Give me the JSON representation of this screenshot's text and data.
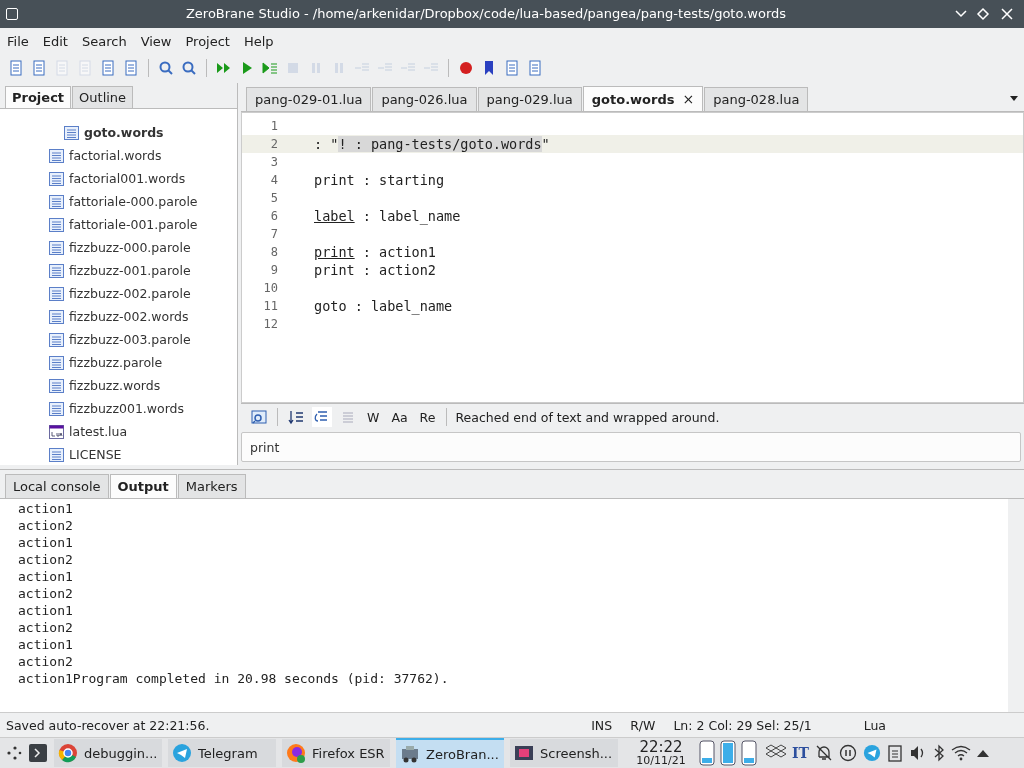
{
  "window": {
    "title": "ZeroBrane Studio - /home/arkenidar/Dropbox/code/lua-based/pangea/pang-tests/goto.words"
  },
  "menu": [
    "File",
    "Edit",
    "Search",
    "View",
    "Project",
    "Help"
  ],
  "toolbar": [
    {
      "kind": "new",
      "disabled": false
    },
    {
      "kind": "open",
      "disabled": false
    },
    {
      "kind": "save",
      "disabled": true
    },
    {
      "kind": "saveall",
      "disabled": true
    },
    {
      "kind": "find-project",
      "disabled": false
    },
    {
      "kind": "folder",
      "disabled": false
    },
    {
      "kind": "sep"
    },
    {
      "kind": "find",
      "disabled": false
    },
    {
      "kind": "replace",
      "disabled": false
    },
    {
      "kind": "sep"
    },
    {
      "kind": "run",
      "disabled": false
    },
    {
      "kind": "play",
      "disabled": false
    },
    {
      "kind": "step",
      "disabled": false
    },
    {
      "kind": "stop",
      "disabled": true
    },
    {
      "kind": "continue",
      "disabled": true
    },
    {
      "kind": "pause",
      "disabled": true
    },
    {
      "kind": "stepin",
      "disabled": true
    },
    {
      "kind": "stepout",
      "disabled": true
    },
    {
      "kind": "stepover",
      "disabled": true
    },
    {
      "kind": "runto",
      "disabled": true
    },
    {
      "kind": "sep"
    },
    {
      "kind": "breakpoint",
      "disabled": false
    },
    {
      "kind": "bookmark",
      "disabled": false
    },
    {
      "kind": "stack",
      "disabled": false
    },
    {
      "kind": "watch",
      "disabled": false
    }
  ],
  "sidebar": {
    "tabs": [
      {
        "label": "Project",
        "selected": true
      },
      {
        "label": "Outline",
        "selected": false
      }
    ],
    "items": [
      {
        "name": "goto.words",
        "kind": "text",
        "current": true,
        "nested": true
      },
      {
        "name": "factorial.words",
        "kind": "text",
        "current": false,
        "nested": false
      },
      {
        "name": "factorial001.words",
        "kind": "text",
        "current": false,
        "nested": false
      },
      {
        "name": "fattoriale-000.parole",
        "kind": "text",
        "current": false,
        "nested": false
      },
      {
        "name": "fattoriale-001.parole",
        "kind": "text",
        "current": false,
        "nested": false
      },
      {
        "name": "fizzbuzz-000.parole",
        "kind": "text",
        "current": false,
        "nested": false
      },
      {
        "name": "fizzbuzz-001.parole",
        "kind": "text",
        "current": false,
        "nested": false
      },
      {
        "name": "fizzbuzz-002.parole",
        "kind": "text",
        "current": false,
        "nested": false
      },
      {
        "name": "fizzbuzz-002.words",
        "kind": "text",
        "current": false,
        "nested": false
      },
      {
        "name": "fizzbuzz-003.parole",
        "kind": "text",
        "current": false,
        "nested": false
      },
      {
        "name": "fizzbuzz.parole",
        "kind": "text",
        "current": false,
        "nested": false
      },
      {
        "name": "fizzbuzz.words",
        "kind": "text",
        "current": false,
        "nested": false
      },
      {
        "name": "fizzbuzz001.words",
        "kind": "text",
        "current": false,
        "nested": false
      },
      {
        "name": "latest.lua",
        "kind": "lua",
        "current": false,
        "nested": false
      },
      {
        "name": "LICENSE",
        "kind": "text",
        "current": false,
        "nested": false
      }
    ]
  },
  "editor": {
    "tabs": [
      {
        "label": "pang-029-01.lua",
        "selected": false
      },
      {
        "label": "pang-026.lua",
        "selected": false
      },
      {
        "label": "pang-029.lua",
        "selected": false
      },
      {
        "label": "goto.words",
        "selected": true
      },
      {
        "label": "pang-028.lua",
        "selected": false
      }
    ],
    "close": "×",
    "lines": [
      {
        "number": "1",
        "current": false
      },
      {
        "number": "2",
        "current": true,
        "parts": [
          {
            "text": ": \"",
            "selected": false,
            "underlined": false
          },
          {
            "text": "! : pang-tests/goto.words",
            "selected": true,
            "underlined": false
          },
          {
            "text": "\"",
            "selected": false,
            "underlined": false
          }
        ]
      },
      {
        "number": "3",
        "current": false
      },
      {
        "number": "4",
        "current": false,
        "parts": [
          {
            "text": "print : starting",
            "selected": false,
            "underlined": false
          }
        ]
      },
      {
        "number": "5",
        "current": false
      },
      {
        "number": "6",
        "current": false,
        "parts": [
          {
            "text": "label",
            "selected": false,
            "underlined": true
          },
          {
            "text": " : label_name",
            "selected": false,
            "underlined": false
          }
        ]
      },
      {
        "number": "7",
        "current": false
      },
      {
        "number": "8",
        "current": false,
        "parts": [
          {
            "text": "print",
            "selected": false,
            "underlined": true
          },
          {
            "text": " : action1",
            "selected": false,
            "underlined": false
          }
        ]
      },
      {
        "number": "9",
        "current": false,
        "parts": [
          {
            "text": "print : action2",
            "selected": false,
            "underlined": false
          }
        ]
      },
      {
        "number": "10",
        "current": false
      },
      {
        "number": "11",
        "current": false,
        "parts": [
          {
            "text": "goto : label_name",
            "selected": false,
            "underlined": false
          }
        ]
      },
      {
        "number": "12",
        "current": false
      }
    ]
  },
  "find": {
    "options": [
      {
        "label": "W",
        "on": false
      },
      {
        "label": "Aa",
        "on": false
      },
      {
        "label": "Re",
        "on": false
      }
    ],
    "wrap_on": true,
    "message": "Reached end of text and wrapped around.",
    "value": "print"
  },
  "panel": {
    "tabs": [
      {
        "label": "Local console",
        "selected": false
      },
      {
        "label": "Output",
        "selected": true
      },
      {
        "label": "Markers",
        "selected": false
      }
    ],
    "output": [
      "action1",
      "action2",
      "action1",
      "action2",
      "action1",
      "action2",
      "action1",
      "action2",
      "action1",
      "action2",
      "action1Program completed in 20.98 seconds (pid: 37762)."
    ]
  },
  "status_bar": {
    "message": "Saved auto-recover at 22:21:56.",
    "mode": "INS",
    "access": "R/W",
    "position": "Ln: 2 Col: 29 Sel: 25/1",
    "language": "Lua"
  },
  "taskbar": {
    "tasks": [
      {
        "label": "debuggin...",
        "kind": "browser",
        "selected": false
      },
      {
        "label": "Telegram",
        "kind": "telegram",
        "selected": false
      },
      {
        "label": "Firefox ESR",
        "kind": "firefox",
        "selected": false
      },
      {
        "label": "ZeroBran...",
        "kind": "ide",
        "selected": true
      },
      {
        "label": "Screensh...",
        "kind": "screenshot",
        "selected": false
      }
    ],
    "time": "22:22",
    "date": "10/11/21",
    "keyboard": "IT"
  }
}
